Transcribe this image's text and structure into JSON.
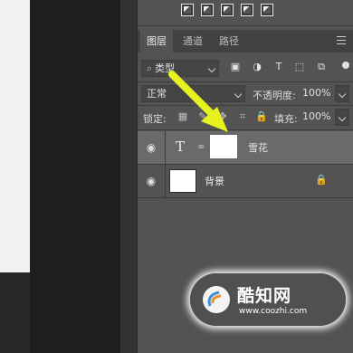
{
  "tabs": [
    {
      "label": "图层",
      "active": true
    },
    {
      "label": "通道",
      "active": false
    },
    {
      "label": "路径",
      "active": false
    }
  ],
  "filter": {
    "kind_label": "类型"
  },
  "blend": {
    "mode": "正常"
  },
  "opacity": {
    "label": "不透明度:",
    "value": "100%"
  },
  "lock": {
    "label": "锁定:"
  },
  "fill": {
    "label": "填充:",
    "value": "100%"
  },
  "layers": [
    {
      "name": "雪花",
      "type_glyph": "T",
      "selected": true
    },
    {
      "name": "背景",
      "selected": false,
      "locked": true
    }
  ],
  "icons": {
    "eye": "👁",
    "text_layer": "T",
    "link": "∞",
    "lock": "🔒",
    "move": "✥"
  },
  "colors": {
    "panel": "#535353",
    "selected_row": "#6a6a6a",
    "arrow": "#e6f21e",
    "canvas": "#f2f2f2"
  },
  "watermark": {
    "name": "酷知网",
    "url": "www.coozhi.com"
  }
}
